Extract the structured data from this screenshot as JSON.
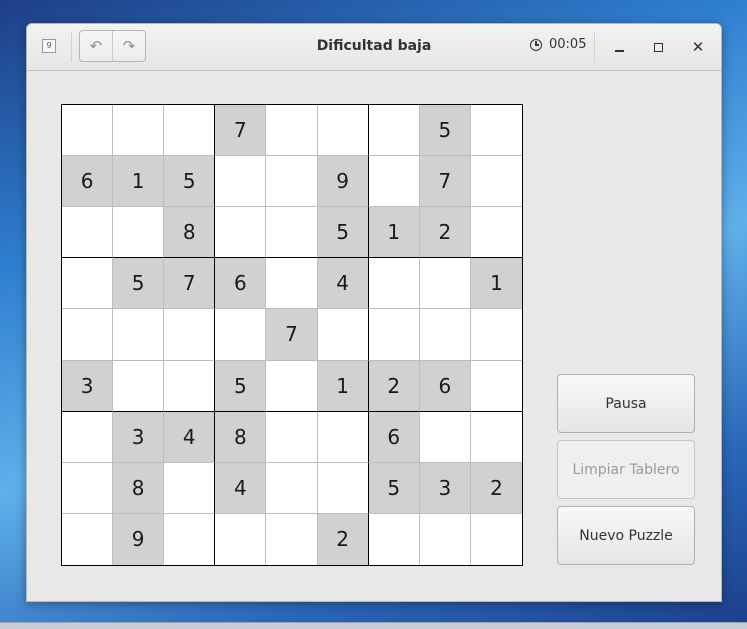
{
  "window": {
    "title": "Dificultad baja",
    "timer": "00:05",
    "app_icon_label": "9"
  },
  "icons": {
    "undo": "undo-icon",
    "redo": "redo-icon",
    "clock": "clock-icon",
    "minimize": "minimize-icon",
    "maximize": "maximize-icon",
    "close": "close-icon"
  },
  "board": {
    "cells": [
      [
        "",
        "",
        "",
        "7",
        "",
        "",
        "",
        "5",
        ""
      ],
      [
        "6",
        "1",
        "5",
        "",
        "",
        "9",
        "",
        "7",
        ""
      ],
      [
        "",
        "",
        "8",
        "",
        "",
        "5",
        "1",
        "2",
        ""
      ],
      [
        "",
        "5",
        "7",
        "6",
        "",
        "4",
        "",
        "",
        "1"
      ],
      [
        "",
        "",
        "",
        "",
        "7",
        "",
        "",
        "",
        ""
      ],
      [
        "3",
        "",
        "",
        "5",
        "",
        "1",
        "2",
        "6",
        ""
      ],
      [
        "",
        "3",
        "4",
        "8",
        "",
        "",
        "6",
        "",
        ""
      ],
      [
        "",
        "8",
        "",
        "4",
        "",
        "",
        "5",
        "3",
        "2"
      ],
      [
        "",
        "9",
        "",
        "",
        "",
        "2",
        "",
        "",
        ""
      ]
    ]
  },
  "buttons": {
    "pause": "Pausa",
    "clear": "Limpiar Tablero",
    "new_puzzle": "Nuevo Puzzle"
  },
  "colors": {
    "given_cell": "#d1d1d1",
    "empty_cell": "#ffffff",
    "window_bg": "#e8e8e7"
  }
}
